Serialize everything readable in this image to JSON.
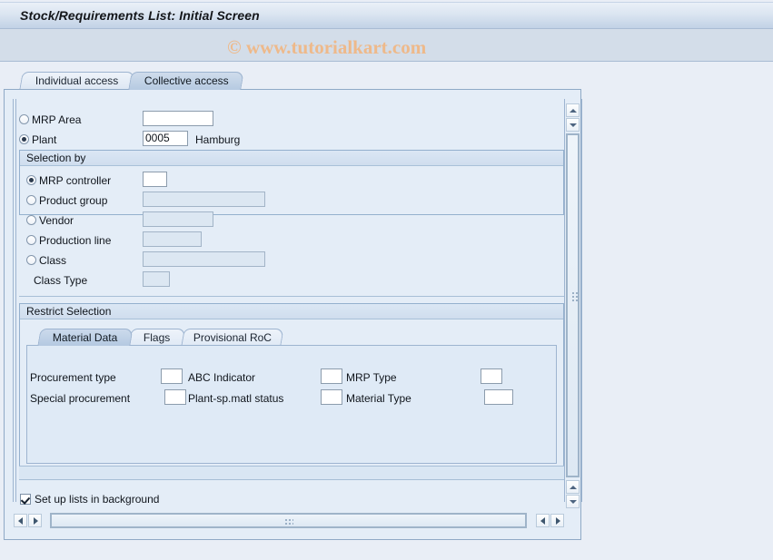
{
  "window": {
    "title": "Stock/Requirements List: Initial Screen",
    "watermark": "© www.tutorialkart.com"
  },
  "tabs": [
    {
      "label": "Individual access",
      "active": false
    },
    {
      "label": "Collective access",
      "active": true
    }
  ],
  "form": {
    "mrp_area": {
      "label": "MRP Area",
      "value": "",
      "selected": false
    },
    "plant": {
      "label": "Plant",
      "value": "0005",
      "selected": true,
      "description": "Hamburg"
    }
  },
  "selection_by": {
    "title": "Selection by",
    "options": [
      {
        "label": "MRP controller",
        "value": "",
        "selected": true,
        "enabled": true
      },
      {
        "label": "Product group",
        "value": "",
        "selected": false,
        "enabled": false
      },
      {
        "label": "Vendor",
        "value": "",
        "selected": false,
        "enabled": false
      },
      {
        "label": "Production line",
        "value": "",
        "selected": false,
        "enabled": false
      },
      {
        "label": "Class",
        "value": "",
        "selected": false,
        "enabled": false
      }
    ],
    "class_type": {
      "label": "Class Type",
      "value": ""
    }
  },
  "restrict_selection": {
    "title": "Restrict Selection",
    "tabs": [
      {
        "label": "Material Data",
        "active": true
      },
      {
        "label": "Flags",
        "active": false
      },
      {
        "label": "Provisional RoC",
        "active": false
      }
    ],
    "material_data": {
      "fields": [
        {
          "label": "Procurement type",
          "value": ""
        },
        {
          "label": "ABC Indicator",
          "value": ""
        },
        {
          "label": "MRP Type",
          "value": ""
        },
        {
          "label": "Special procurement",
          "value": ""
        },
        {
          "label": "Plant-sp.matl status",
          "value": ""
        },
        {
          "label": "Material Type",
          "value": ""
        }
      ]
    }
  },
  "footer": {
    "background_checkbox": {
      "label": "Set up lists in background",
      "checked": true
    }
  },
  "colors": {
    "page_background": "#e9eef6",
    "title_bar": "#c2d2e6",
    "toolbar": "#d3dde9",
    "panel": "#e4edf7",
    "active_tab": "#b6cae1",
    "watermark": "#eeb98a",
    "border": "#8fa9c6"
  }
}
